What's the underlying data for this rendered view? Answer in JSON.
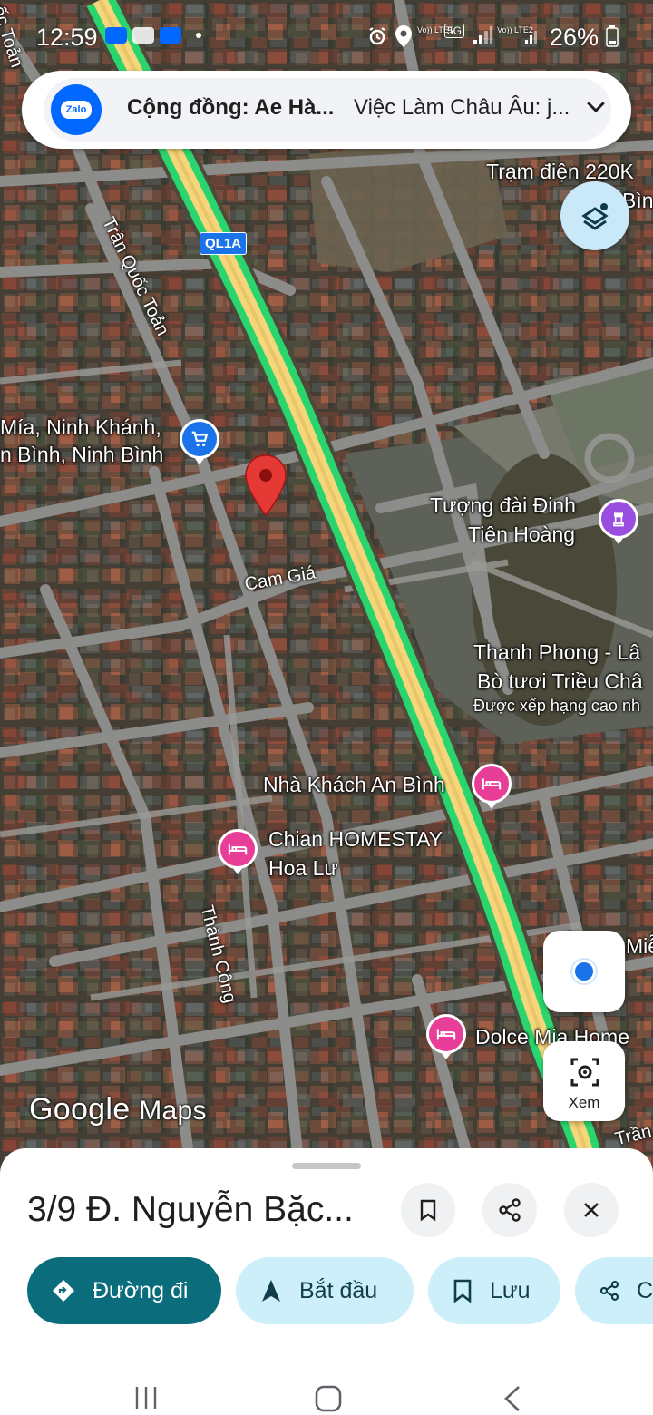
{
  "status_bar": {
    "time": "12:59",
    "battery": "26%",
    "sim1": "Vo)) LTE1",
    "sim2": "Vo)) LTE2",
    "network": "5G"
  },
  "notification": {
    "app": "Zalo",
    "title": "Cộng đồng: Ae Hà...",
    "text": "Việc Làm Châu Âu: j..."
  },
  "map": {
    "highway_shield": "QL1A",
    "labels": {
      "tran_quoc_toan_top": "ốc Toản",
      "tran_quoc_toan": "Trần Quốc Toản",
      "tram_dien_1": "Trạm điện 220K",
      "tram_dien_2": "Bìn",
      "ninh_khanh_1": "Mía, Ninh Khánh,",
      "ninh_khanh_2": "n Bình, Ninh Bình",
      "tuong_dai_1": "Tượng đài Đinh",
      "tuong_dai_2": "Tiên Hoàng",
      "cam_gia": "Cam Giá",
      "thanh_phong_1": "Thanh Phong - Lâ",
      "thanh_phong_2": "Bò tươi Triều Châ",
      "thanh_phong_3": "Được xếp hạng cao nh",
      "nha_khach": "Nhà Khách An Bình",
      "chian_1": "Chian HOMESTAY",
      "chian_2": "Hoa Lư",
      "thanh_cong": "Thành Công",
      "mien": "Miễ",
      "dolce": "Dolce Mia Home",
      "tran_bottom": "Trần"
    },
    "google_logo": "Google",
    "maps_logo": "Maps"
  },
  "buttons": {
    "view_label": "Xem"
  },
  "sheet": {
    "place_title": "3/9 Đ. Nguyễn Bặc...",
    "chips": {
      "directions": "Đường đi",
      "start": "Bắt đầu",
      "save": "Lưu",
      "share": "C"
    }
  },
  "colors": {
    "accent_teal": "#0b6c7c",
    "chip_light": "#cdeff9",
    "highway_green": "#2bd56e",
    "highway_yellow": "#f5d67a",
    "pin_red": "#e53935",
    "poi_pink": "#e83e97"
  }
}
